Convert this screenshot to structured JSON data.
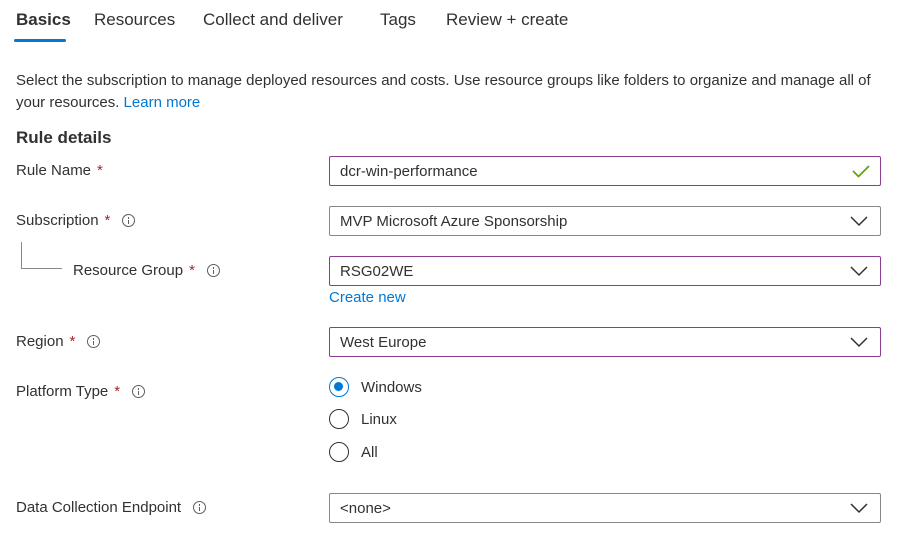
{
  "tabs": [
    "Basics",
    "Resources",
    "Collect and deliver",
    "Tags",
    "Review + create"
  ],
  "description": {
    "text": "Select the subscription to manage deployed resources and costs. Use resource groups like folders to organize and manage all of your resources.",
    "link": "Learn more"
  },
  "section_title": "Rule details",
  "fields": {
    "rule_name": {
      "label": "Rule Name",
      "required": "*",
      "value": "dcr-win-performance"
    },
    "subscription": {
      "label": "Subscription",
      "required": "*",
      "value": "MVP Microsoft Azure Sponsorship"
    },
    "resource_group": {
      "label": "Resource Group",
      "required": "*",
      "value": "RSG02WE",
      "create_new": "Create new"
    },
    "region": {
      "label": "Region",
      "required": "*",
      "value": "West Europe"
    },
    "platform_type": {
      "label": "Platform Type",
      "required": "*",
      "options": [
        "Windows",
        "Linux",
        "All"
      ],
      "selected": "Windows"
    },
    "data_collection_endpoint": {
      "label": "Data Collection Endpoint",
      "value": "<none>"
    }
  },
  "colors": {
    "accent": "#0078d4",
    "focus_border": "#8a3c93",
    "required": "#a4262c",
    "valid": "#57a300"
  },
  "icons": {
    "info": "info-icon",
    "dropdown": "chevron-down-icon",
    "valid": "checkmark-icon"
  }
}
